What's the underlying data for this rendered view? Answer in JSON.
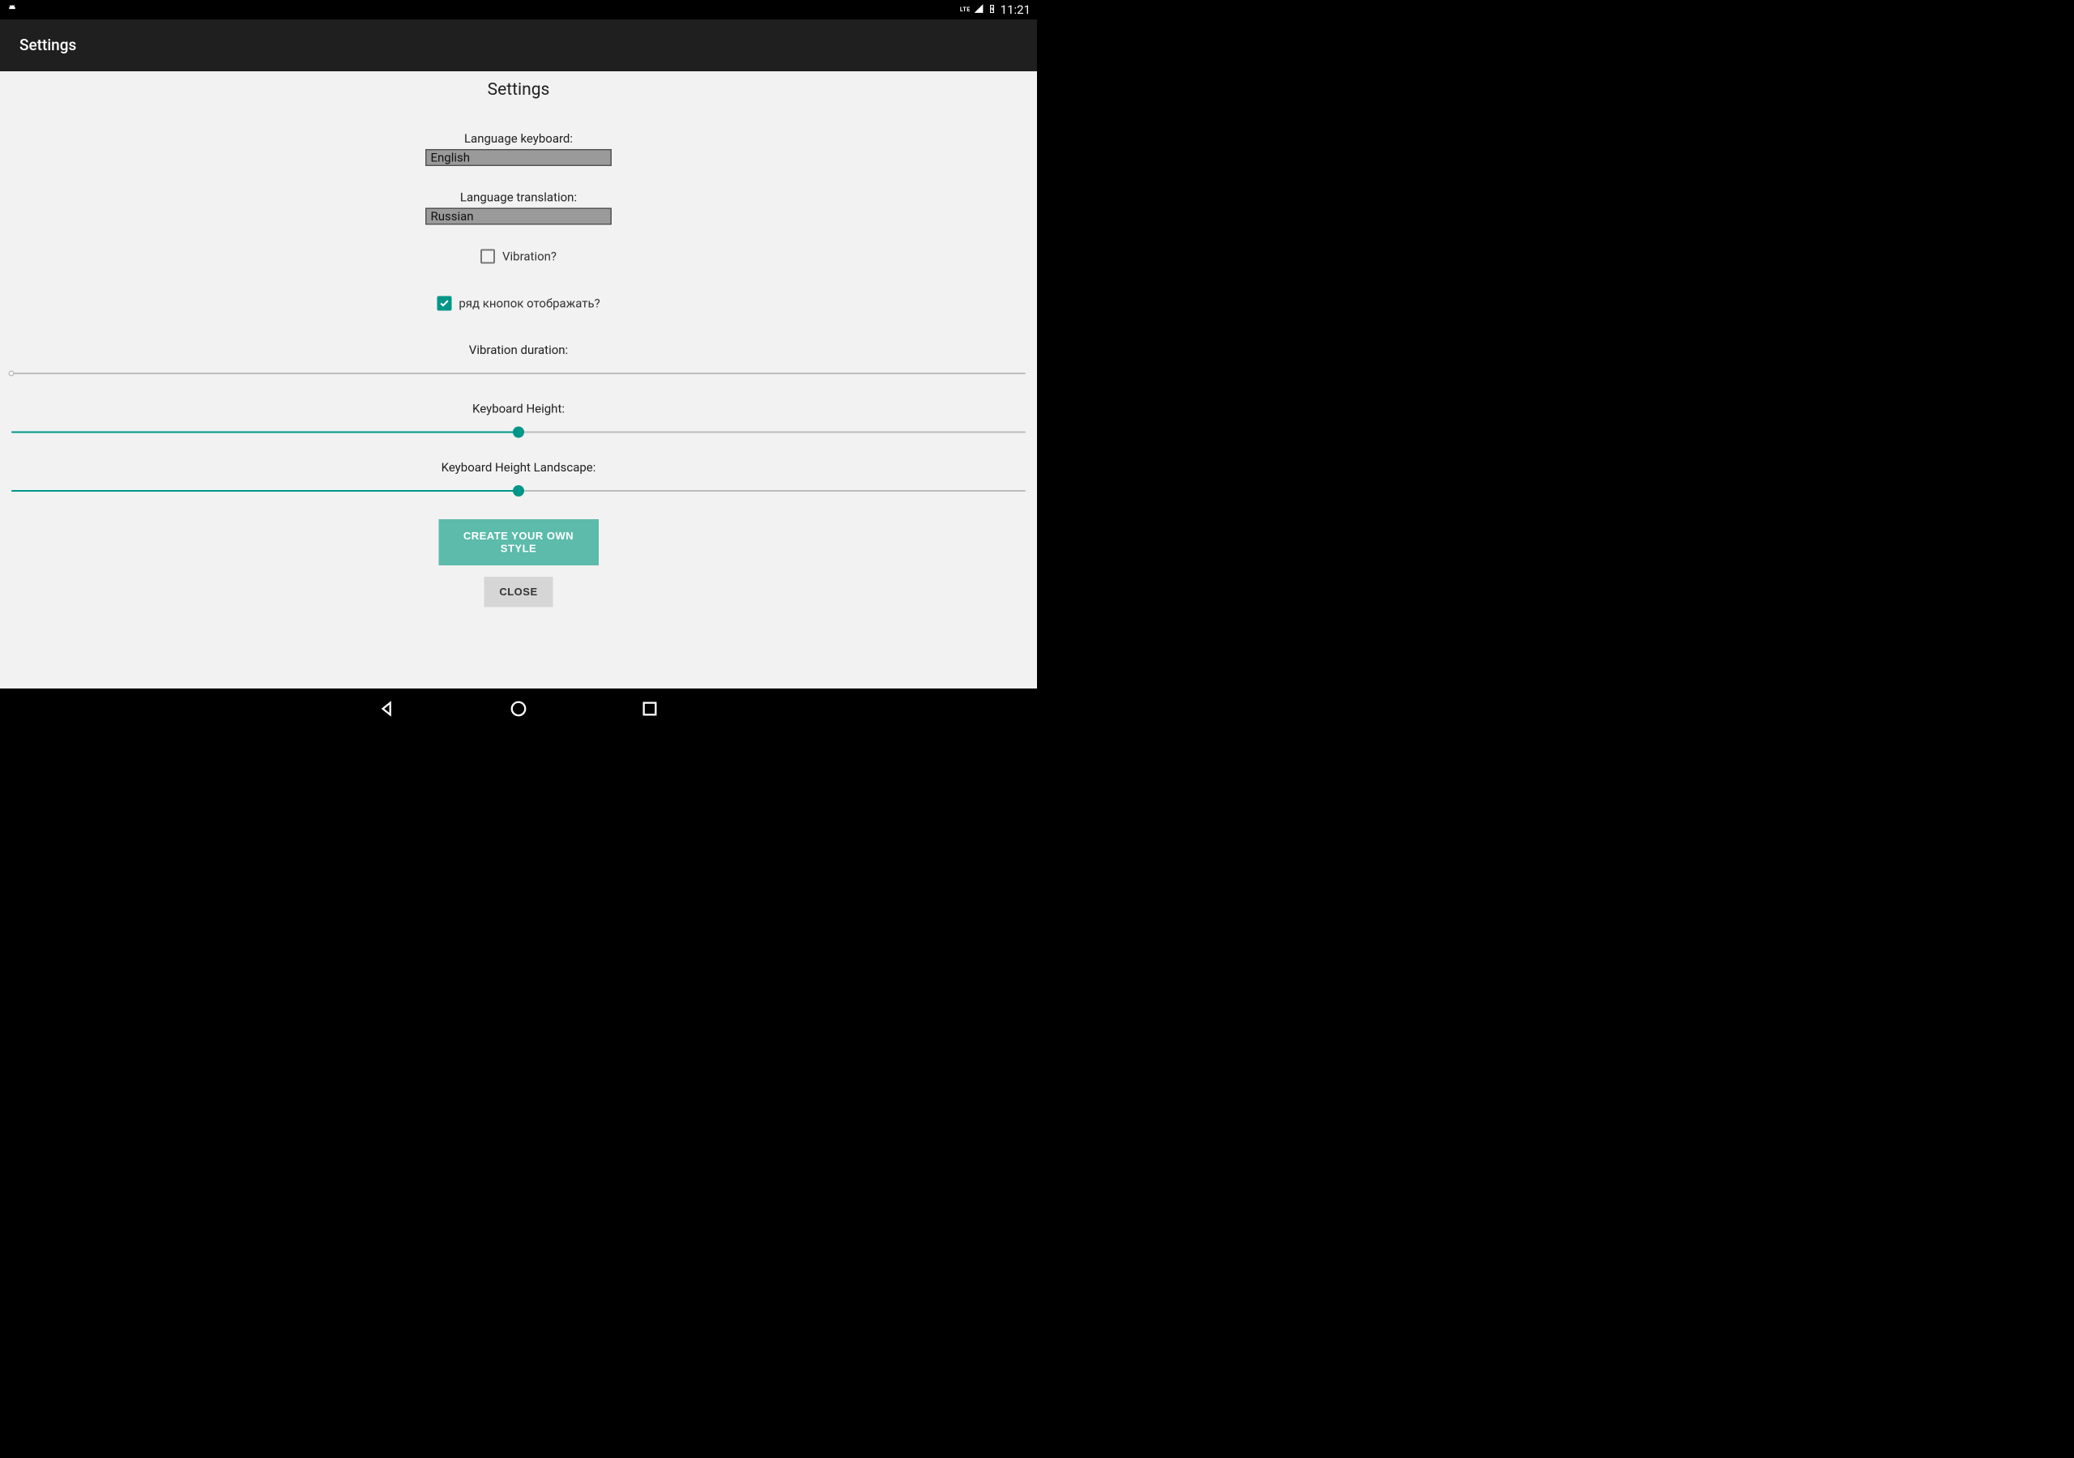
{
  "status_bar": {
    "time": "11:21",
    "lte": "LTE"
  },
  "app_bar": {
    "title": "Settings"
  },
  "page": {
    "title": "Settings",
    "language_keyboard_label": "Language keyboard:",
    "language_keyboard_value": "English",
    "language_translation_label": "Language translation:",
    "language_translation_value": "Russian",
    "vibration_label": "Vibration?",
    "vibration_checked": false,
    "row_buttons_label": "ряд кнопок отображать?",
    "row_buttons_checked": true,
    "vibration_duration_label": "Vibration duration:",
    "vibration_duration_value": 0,
    "keyboard_height_label": "Keyboard Height:",
    "keyboard_height_value": 50,
    "keyboard_height_landscape_label": "Keyboard Height Landscape:",
    "keyboard_height_landscape_value": 50,
    "create_style_button": "CREATE YOUR OWN STYLE",
    "close_button": "CLOSE"
  },
  "colors": {
    "accent": "#009688",
    "button_primary": "#5cbbab",
    "background": "#f2f2f2"
  }
}
